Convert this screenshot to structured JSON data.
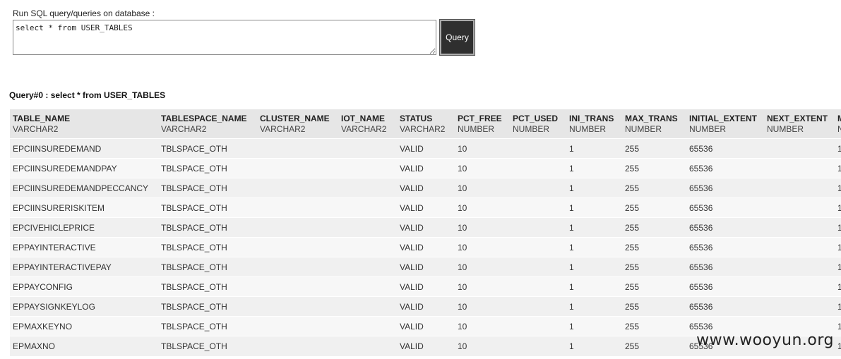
{
  "form": {
    "label": "Run SQL query/queries on database :",
    "query_text": "select * from USER_TABLES",
    "button_label": "Query"
  },
  "result": {
    "title": "Query#0 : select * from USER_TABLES",
    "columns": [
      {
        "name": "TABLE_NAME",
        "type": "VARCHAR2"
      },
      {
        "name": "TABLESPACE_NAME",
        "type": "VARCHAR2"
      },
      {
        "name": "CLUSTER_NAME",
        "type": "VARCHAR2"
      },
      {
        "name": "IOT_NAME",
        "type": "VARCHAR2"
      },
      {
        "name": "STATUS",
        "type": "VARCHAR2"
      },
      {
        "name": "PCT_FREE",
        "type": "NUMBER"
      },
      {
        "name": "PCT_USED",
        "type": "NUMBER"
      },
      {
        "name": "INI_TRANS",
        "type": "NUMBER"
      },
      {
        "name": "MAX_TRANS",
        "type": "NUMBER"
      },
      {
        "name": "INITIAL_EXTENT",
        "type": "NUMBER"
      },
      {
        "name": "NEXT_EXTENT",
        "type": "NUMBER"
      },
      {
        "name": "M",
        "type": "N"
      }
    ],
    "rows": [
      [
        "EPCIINSUREDEMAND",
        "TBLSPACE_OTH",
        "",
        "",
        "VALID",
        "10",
        "",
        "1",
        "255",
        "65536",
        "",
        "1"
      ],
      [
        "EPCIINSUREDEMANDPAY",
        "TBLSPACE_OTH",
        "",
        "",
        "VALID",
        "10",
        "",
        "1",
        "255",
        "65536",
        "",
        "1"
      ],
      [
        "EPCIINSUREDEMANDPECCANCY",
        "TBLSPACE_OTH",
        "",
        "",
        "VALID",
        "10",
        "",
        "1",
        "255",
        "65536",
        "",
        "1"
      ],
      [
        "EPCIINSURERISKITEM",
        "TBLSPACE_OTH",
        "",
        "",
        "VALID",
        "10",
        "",
        "1",
        "255",
        "65536",
        "",
        "1"
      ],
      [
        "EPCIVEHICLEPRICE",
        "TBLSPACE_OTH",
        "",
        "",
        "VALID",
        "10",
        "",
        "1",
        "255",
        "65536",
        "",
        "1"
      ],
      [
        "EPPAYINTERACTIVE",
        "TBLSPACE_OTH",
        "",
        "",
        "VALID",
        "10",
        "",
        "1",
        "255",
        "65536",
        "",
        "1"
      ],
      [
        "EPPAYINTERACTIVEPAY",
        "TBLSPACE_OTH",
        "",
        "",
        "VALID",
        "10",
        "",
        "1",
        "255",
        "65536",
        "",
        "1"
      ],
      [
        "EPPAYCONFIG",
        "TBLSPACE_OTH",
        "",
        "",
        "VALID",
        "10",
        "",
        "1",
        "255",
        "65536",
        "",
        "1"
      ],
      [
        "EPPAYSIGNKEYLOG",
        "TBLSPACE_OTH",
        "",
        "",
        "VALID",
        "10",
        "",
        "1",
        "255",
        "65536",
        "",
        "1"
      ],
      [
        "EPMAXKEYNO",
        "TBLSPACE_OTH",
        "",
        "",
        "VALID",
        "10",
        "",
        "1",
        "255",
        "65536",
        "",
        "1"
      ],
      [
        "EPMAXNO",
        "TBLSPACE_OTH",
        "",
        "",
        "VALID",
        "10",
        "",
        "1",
        "255",
        "65536",
        "",
        "1"
      ]
    ]
  },
  "watermark": "www.wooyun.org"
}
